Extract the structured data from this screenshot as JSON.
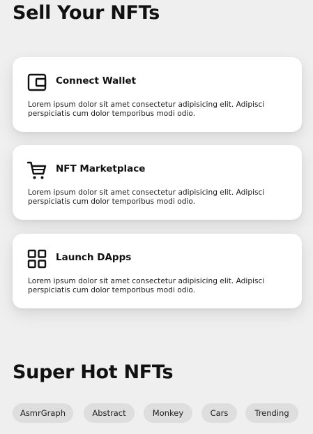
{
  "sections": {
    "sell_title": "Sell Your NFTs",
    "hot_title": "Super Hot NFTs"
  },
  "cards": [
    {
      "icon": "wallet-icon",
      "title": "Connect Wallet",
      "description": "Lorem ipsum dolor sit amet consectetur adipisicing elit. Adipisci perspiciatis cum dolor temporibus modi odio."
    },
    {
      "icon": "cart-icon",
      "title": "NFT Marketplace",
      "description": "Lorem ipsum dolor sit amet consectetur adipisicing elit. Adipisci perspiciatis cum dolor temporibus modi odio."
    },
    {
      "icon": "apps-grid-icon",
      "title": "Launch DApps",
      "description": "Lorem ipsum dolor sit amet consectetur adipisicing elit. Adipisci perspiciatis cum dolor temporibus modi odio."
    }
  ],
  "filters": [
    "AsmrGraph",
    "Abstract",
    "Monkey",
    "Cars",
    "Trending"
  ],
  "colors": {
    "background": "#efefef",
    "card": "#ffffff",
    "chip": "#dedede",
    "text": "#111111"
  }
}
